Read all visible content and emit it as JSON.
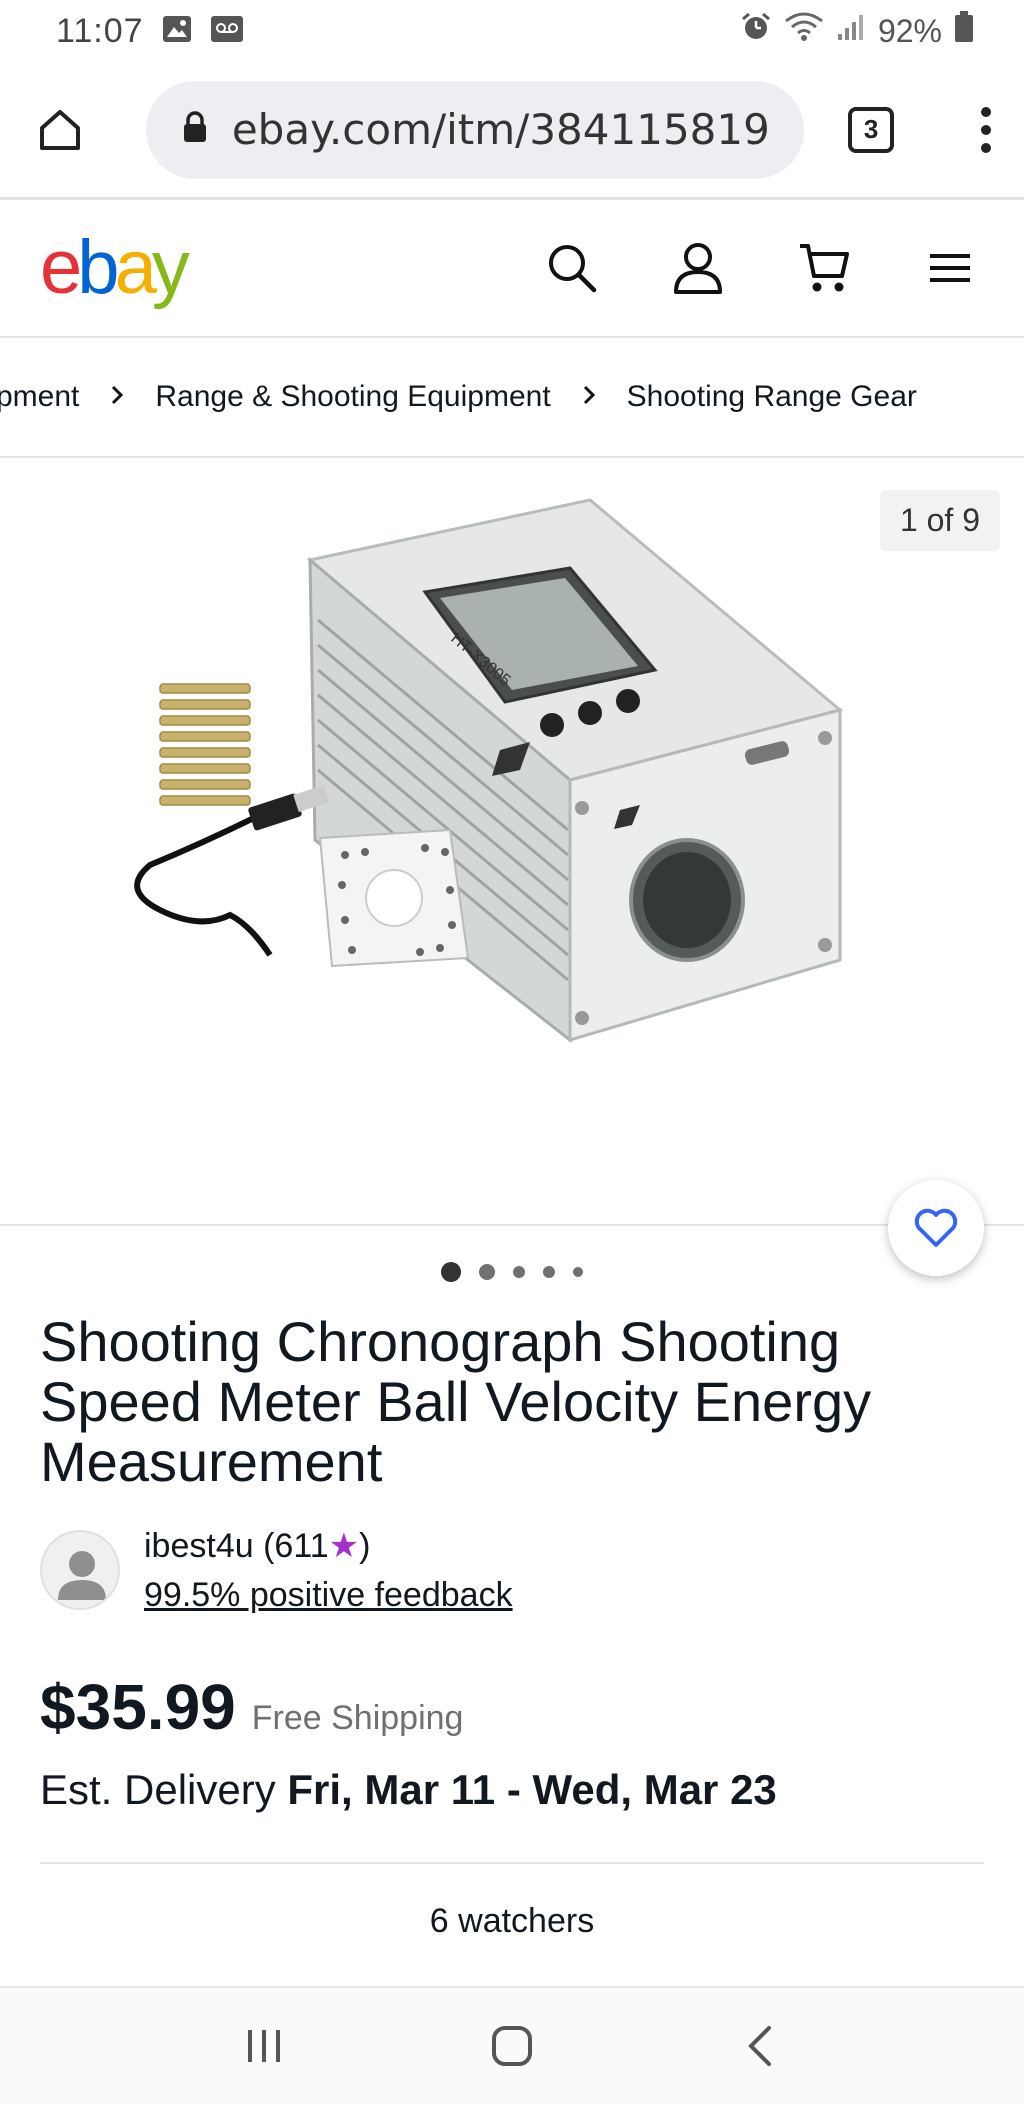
{
  "status_bar": {
    "time": "11:07",
    "battery": "92%",
    "icons": [
      "image-icon",
      "voicemail-icon",
      "alarm-icon",
      "wifi-icon",
      "signal-icon",
      "battery-icon"
    ]
  },
  "browser": {
    "url": "ebay.com/itm/384115819",
    "tab_count": "3",
    "icons": [
      "home-icon",
      "lock-icon",
      "more-vert-icon"
    ]
  },
  "header": {
    "logo": [
      "e",
      "b",
      "a",
      "y"
    ],
    "icons": [
      "search-icon",
      "account-icon",
      "cart-icon",
      "menu-icon"
    ],
    "brand_colors": [
      "#e53238",
      "#0064d2",
      "#f5af02",
      "#86b817"
    ]
  },
  "breadcrumbs": [
    "pment",
    "Range & Shooting Equipment",
    "Shooting Range Gear"
  ],
  "gallery": {
    "counter": "1 of 9",
    "dot_count": 5,
    "active_dot": 0,
    "device_label": "HT-X3005"
  },
  "listing": {
    "title": "Shooting Chronograph Shooting Speed Meter Ball Velocity Energy Measurement",
    "seller_name": "ibest4u (611",
    "seller_name_suffix": ")",
    "seller_feedback": "99.5% positive feedback",
    "price": "$35.99",
    "shipping": "Free Shipping",
    "delivery_label": "Est. Delivery",
    "delivery_dates": "Fri, Mar 11 - Wed, Mar 23",
    "watchers": "6 watchers"
  },
  "nav": {
    "icons": [
      "recent-apps-icon",
      "home-nav-icon",
      "back-icon"
    ]
  }
}
